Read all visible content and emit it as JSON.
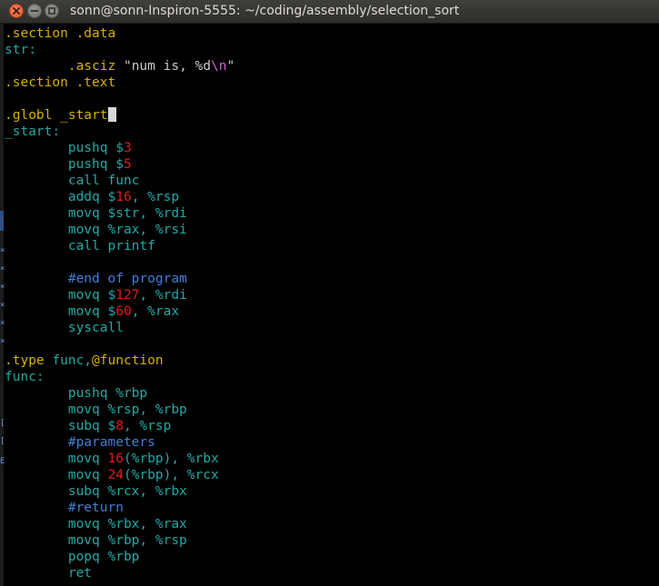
{
  "window": {
    "title": "sonn@sonn-Inspiron-5555: ~/coding/assembly/selection_sort",
    "buttons": {
      "close_icon": "close-icon",
      "minimize_icon": "minimize-icon",
      "maximize_icon": "maximize-icon"
    }
  },
  "editor": {
    "colors": {
      "background": "#000000",
      "directive": "#d7b000",
      "text": "#22a8a4",
      "number": "#e01a1a",
      "comment": "#3f7fd6",
      "string": "#c9c9c9",
      "cursor": "#d8d8d8"
    },
    "lines": [
      [
        {
          "t": ".section .data",
          "c": "dir"
        }
      ],
      [
        {
          "t": "str:",
          "c": "lbl"
        }
      ],
      [
        {
          "t": "        ",
          "c": "plain"
        },
        {
          "t": ".asciz",
          "c": "dir"
        },
        {
          "t": " ",
          "c": "plain"
        },
        {
          "t": "\"num is, %d",
          "c": "str"
        },
        {
          "t": "\\n",
          "c": "esc"
        },
        {
          "t": "\"",
          "c": "str"
        }
      ],
      [
        {
          "t": ".section .text",
          "c": "dir"
        }
      ],
      [],
      [
        {
          "t": ".globl _start",
          "c": "dir"
        },
        {
          "t": "",
          "c": "cursor"
        }
      ],
      [
        {
          "t": "_start:",
          "c": "lbl"
        }
      ],
      [
        {
          "t": "        pushq $",
          "c": "ins"
        },
        {
          "t": "3",
          "c": "num"
        }
      ],
      [
        {
          "t": "        pushq $",
          "c": "ins"
        },
        {
          "t": "5",
          "c": "num"
        }
      ],
      [
        {
          "t": "        call func",
          "c": "ins"
        }
      ],
      [
        {
          "t": "        addq $",
          "c": "ins"
        },
        {
          "t": "16",
          "c": "num"
        },
        {
          "t": ", %rsp",
          "c": "ins"
        }
      ],
      [
        {
          "t": "        movq $str, %rdi",
          "c": "ins"
        }
      ],
      [
        {
          "t": "        movq %rax, %rsi",
          "c": "ins"
        }
      ],
      [
        {
          "t": "        call printf",
          "c": "ins"
        }
      ],
      [],
      [
        {
          "t": "        #end of program",
          "c": "com"
        }
      ],
      [
        {
          "t": "        movq $",
          "c": "ins"
        },
        {
          "t": "127",
          "c": "num"
        },
        {
          "t": ", %rdi",
          "c": "ins"
        }
      ],
      [
        {
          "t": "        movq $",
          "c": "ins"
        },
        {
          "t": "60",
          "c": "num"
        },
        {
          "t": ", %rax",
          "c": "ins"
        }
      ],
      [
        {
          "t": "        syscall",
          "c": "ins"
        }
      ],
      [],
      [
        {
          "t": ".type",
          "c": "dir"
        },
        {
          "t": " func,",
          "c": "ins"
        },
        {
          "t": "@function",
          "c": "dir"
        }
      ],
      [
        {
          "t": "func:",
          "c": "lbl"
        }
      ],
      [
        {
          "t": "        pushq %rbp",
          "c": "ins"
        }
      ],
      [
        {
          "t": "        movq %rsp, %rbp",
          "c": "ins"
        }
      ],
      [
        {
          "t": "        subq $",
          "c": "ins"
        },
        {
          "t": "8",
          "c": "num"
        },
        {
          "t": ", %rsp",
          "c": "ins"
        }
      ],
      [
        {
          "t": "        #parameters",
          "c": "com"
        }
      ],
      [
        {
          "t": "        movq ",
          "c": "ins"
        },
        {
          "t": "16",
          "c": "num"
        },
        {
          "t": "(%rbp), %rbx",
          "c": "ins"
        }
      ],
      [
        {
          "t": "        movq ",
          "c": "ins"
        },
        {
          "t": "24",
          "c": "num"
        },
        {
          "t": "(%rbp), %rcx",
          "c": "ins"
        }
      ],
      [
        {
          "t": "        subq %rcx, %rbx",
          "c": "ins"
        }
      ],
      [
        {
          "t": "        #return",
          "c": "com"
        }
      ],
      [
        {
          "t": "        movq %rbx, %rax",
          "c": "ins"
        }
      ],
      [
        {
          "t": "        movq %rbp, %rsp",
          "c": "ins"
        }
      ],
      [
        {
          "t": "        popq %rbp",
          "c": "ins"
        }
      ],
      [
        {
          "t": "        ret",
          "c": "ins"
        }
      ]
    ]
  },
  "background_window_edge": {
    "marks": [
      "×",
      "×",
      "×",
      "×",
      "×",
      "×",
      "[",
      "[",
      "E"
    ]
  }
}
